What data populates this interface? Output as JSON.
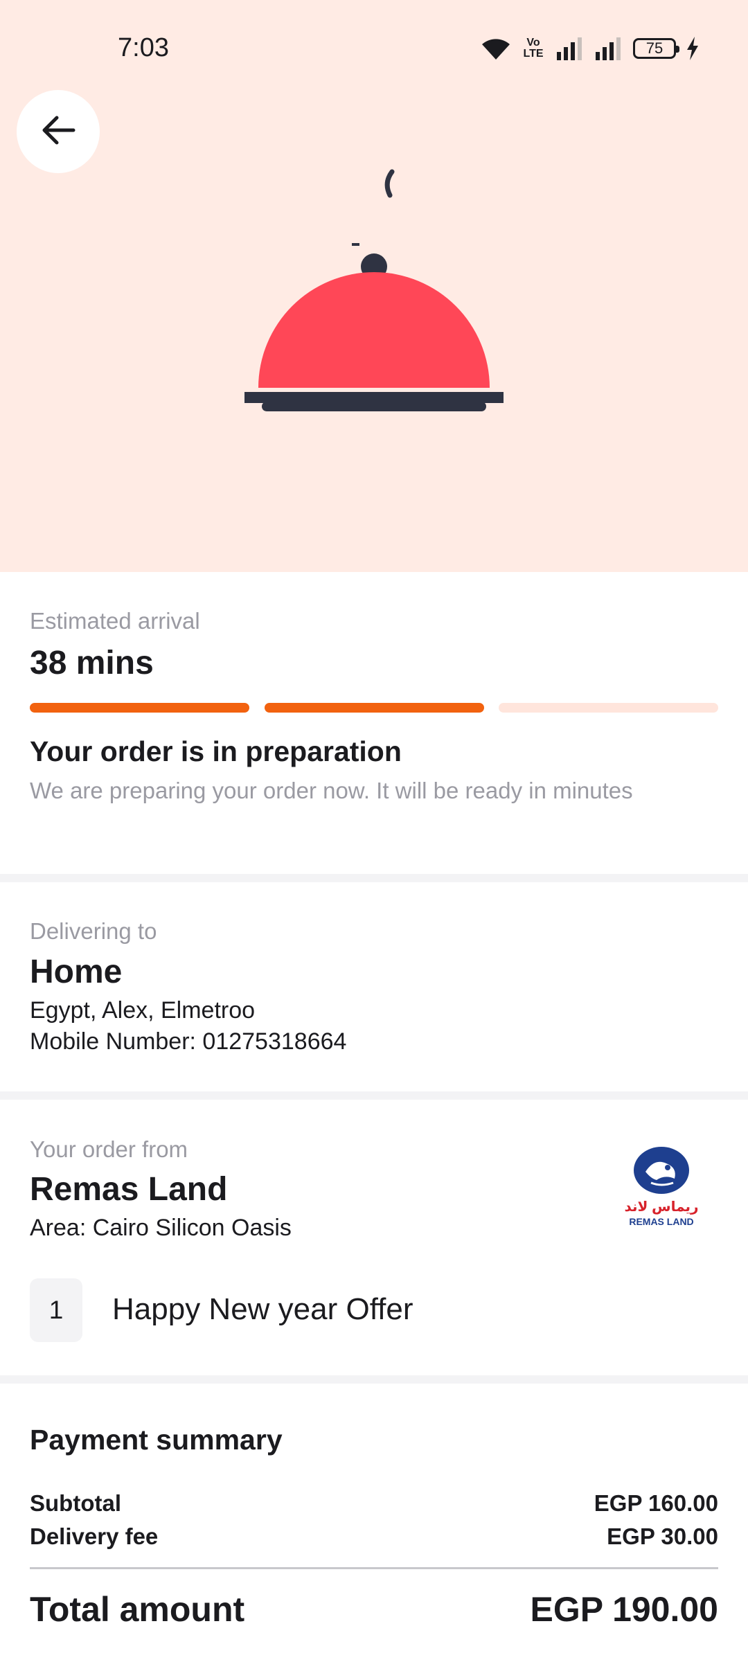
{
  "status_bar": {
    "time": "7:03",
    "network_label": "Vo LTE",
    "battery": "75",
    "icons": [
      "wifi-icon",
      "volte-icon",
      "signal-icon",
      "signal-icon",
      "battery-icon",
      "charging-bolt-icon"
    ]
  },
  "header": {
    "back_icon": "arrow-left-icon",
    "illustration": "cloche-icon"
  },
  "colors": {
    "hero_background": "#ffebe4",
    "accent": "#f2620f",
    "accent_light": "#ffe5dc",
    "cloche_red": "#ff4757",
    "cloche_dark": "#2f3342"
  },
  "arrival": {
    "label": "Estimated arrival",
    "value": "38 mins",
    "progress_steps_total": 3,
    "progress_steps_completed": 2
  },
  "order_status": {
    "title": "Your order is in preparation",
    "description": "We are preparing your order now. It will be ready in minutes"
  },
  "delivery": {
    "label": "Delivering to",
    "name": "Home",
    "address": "Egypt, Alex, Elmetroo",
    "mobile": "Mobile Number: 01275318664"
  },
  "restaurant": {
    "label": "Your order from",
    "name": "Remas Land",
    "area": "Area: Cairo Silicon Oasis",
    "logo_text_ar": "ريماس لاند",
    "logo_text_en": "REMAS LAND",
    "items": [
      {
        "qty": "1",
        "name": "Happy New year Offer"
      }
    ]
  },
  "payment": {
    "title": "Payment summary",
    "rows": [
      {
        "label": "Subtotal",
        "value": "EGP 160.00"
      },
      {
        "label": "Delivery fee",
        "value": "EGP 30.00"
      }
    ],
    "total_label": "Total amount",
    "total_value": "EGP 190.00"
  }
}
